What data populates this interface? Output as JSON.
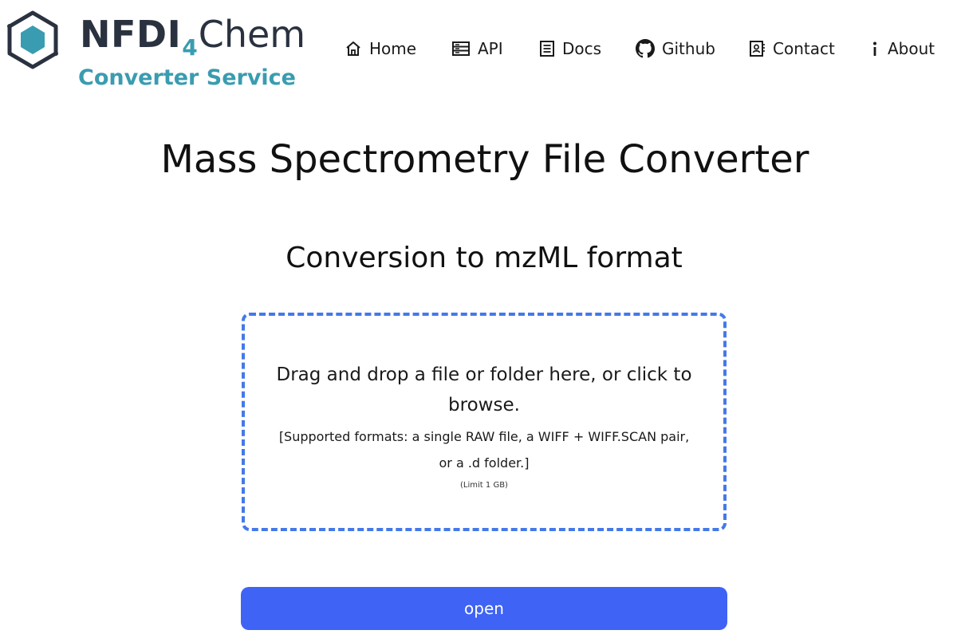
{
  "brand": {
    "wordmark_nfdi": "NFDI",
    "wordmark_four": "4",
    "wordmark_chem": "Chem",
    "subtitle": "Converter Service"
  },
  "nav": {
    "items": [
      {
        "label": "Home",
        "icon": "home-icon"
      },
      {
        "label": "API",
        "icon": "server-icon"
      },
      {
        "label": "Docs",
        "icon": "document-icon"
      },
      {
        "label": "Github",
        "icon": "github-icon"
      },
      {
        "label": "Contact",
        "icon": "contact-card-icon"
      },
      {
        "label": "About",
        "icon": "info-icon"
      }
    ]
  },
  "main": {
    "title": "Mass Spectrometry File Converter",
    "section_title": "Conversion to mzML format",
    "dropzone": {
      "instruction": "Drag and drop a file or folder here, or click to browse.",
      "formats": "[Supported formats: a single RAW file, a WIFF + WIFF.SCAN pair, or a .d folder.]",
      "limit": "(Limit 1 GB)"
    },
    "open_button_label": "open"
  },
  "colors": {
    "accent": "#3a9cb0",
    "brand_dark": "#2a3240",
    "dropzone_border": "#4479e8",
    "button_bg": "#3e63f5"
  }
}
